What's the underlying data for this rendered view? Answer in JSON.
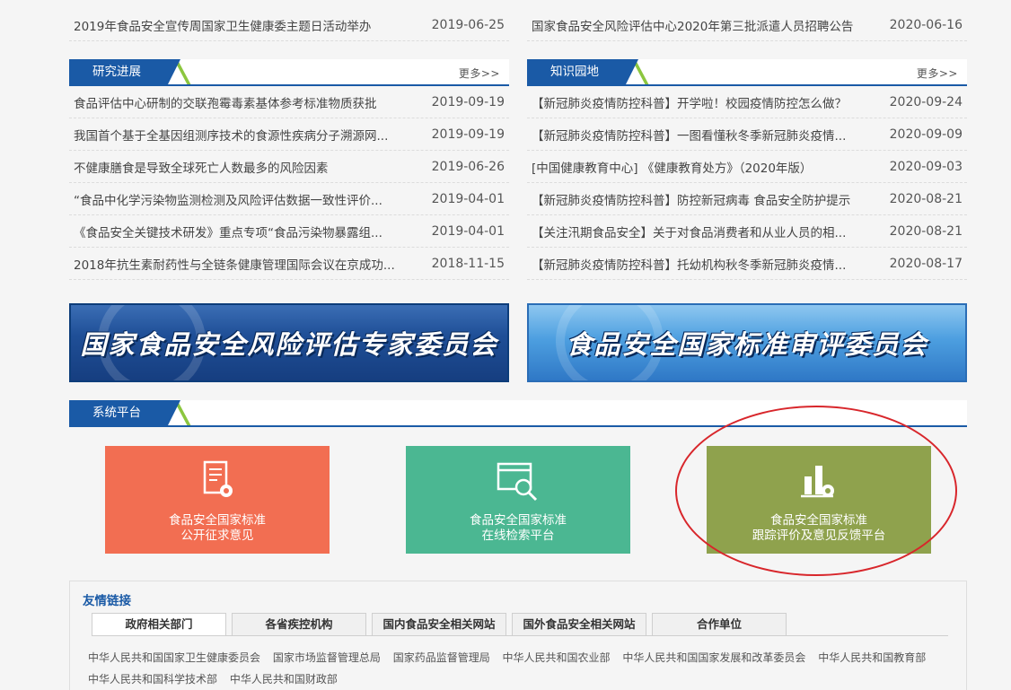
{
  "top_rows": {
    "left": {
      "title": "2019年食品安全宣传周国家卫生健康委主题日活动举办",
      "date": "2019-06-25"
    },
    "right": {
      "title": "国家食品安全风险评估中心2020年第三批派遣人员招聘公告",
      "date": "2020-06-16"
    }
  },
  "research": {
    "title": "研究进展",
    "more": "更多>>",
    "items": [
      {
        "title": "食品评估中心研制的交联孢霉毒素基体参考标准物质获批",
        "date": "2019-09-19"
      },
      {
        "title": "我国首个基于全基因组测序技术的食源性疾病分子溯源网...",
        "date": "2019-09-19"
      },
      {
        "title": "不健康膳食是导致全球死亡人数最多的风险因素",
        "date": "2019-06-26"
      },
      {
        "title": "“食品中化学污染物监测检测及风险评估数据一致性评价...",
        "date": "2019-04-01"
      },
      {
        "title": "《食品安全关键技术研发》重点专项“食品污染物暴露组...",
        "date": "2019-04-01"
      },
      {
        "title": "2018年抗生素耐药性与全链条健康管理国际会议在京成功...",
        "date": "2018-11-15"
      }
    ]
  },
  "knowledge": {
    "title": "知识园地",
    "more": "更多>>",
    "items": [
      {
        "title": "【新冠肺炎疫情防控科普】开学啦！校园疫情防控怎么做？",
        "date": "2020-09-24"
      },
      {
        "title": "【新冠肺炎疫情防控科普】一图看懂秋冬季新冠肺炎疫情...",
        "date": "2020-09-09"
      },
      {
        "title": "[中国健康教育中心] 《健康教育处方》（2020年版）",
        "date": "2020-09-03"
      },
      {
        "title": "【新冠肺炎疫情防控科普】防控新冠病毒 食品安全防护提示",
        "date": "2020-08-21"
      },
      {
        "title": "【关注汛期食品安全】关于对食品消费者和从业人员的相...",
        "date": "2020-08-21"
      },
      {
        "title": "【新冠肺炎疫情防控科普】托幼机构秋冬季新冠肺炎疫情...",
        "date": "2020-08-17"
      }
    ]
  },
  "banners": [
    {
      "text": "国家食品安全风险评估专家委员会"
    },
    {
      "text": "食品安全国家标准审评委员会"
    }
  ],
  "system": {
    "title": "系统平台",
    "platforms": [
      {
        "line1": "食品安全国家标准",
        "line2": "公开征求意见",
        "color": "#f26e52",
        "icon": "document-gear-icon"
      },
      {
        "line1": "食品安全国家标准",
        "line2": "在线检索平台",
        "color": "#4bb792",
        "icon": "browser-search-icon"
      },
      {
        "line1": "食品安全国家标准",
        "line2": "跟踪评价及意见反馈平台",
        "color": "#8fa24d",
        "icon": "bar-chart-gear-icon"
      }
    ]
  },
  "links": {
    "title": "友情链接",
    "tabs": [
      "政府相关部门",
      "各省疾控机构",
      "国内食品安全相关网站",
      "国外食品安全相关网站",
      "合作单位"
    ],
    "items": [
      "中华人民共和国国家卫生健康委员会",
      "国家市场监督管理总局",
      "国家药品监督管理局",
      "中华人民共和国农业部",
      "中华人民共和国国家发展和改革委员会",
      "中华人民共和国教育部",
      "中华人民共和国科学技术部",
      "中华人民共和国财政部"
    ]
  },
  "colors": {
    "accent": "#1a5aa6",
    "highlight_circle": "#d8262b"
  }
}
